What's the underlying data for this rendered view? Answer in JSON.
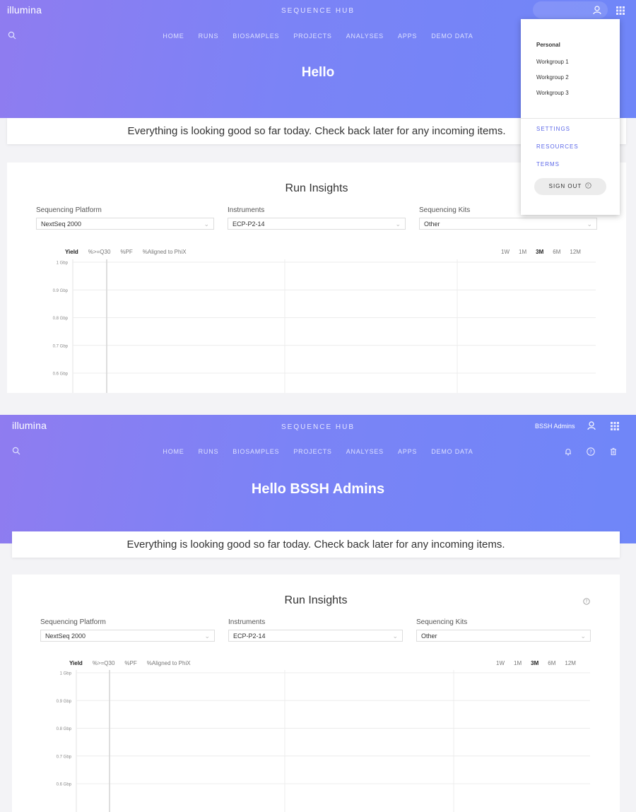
{
  "brand": "illumina",
  "app_title": "SEQUENCE HUB",
  "nav": [
    "HOME",
    "RUNS",
    "BIOSAMPLES",
    "PROJECTS",
    "ANALYSES",
    "APPS",
    "DEMO DATA"
  ],
  "status_message": "Everything is looking good so far today. Check back later for any incoming items.",
  "insights": {
    "title": "Run Insights",
    "filters": {
      "platform_label": "Sequencing Platform",
      "platform_value": "NextSeq 2000",
      "instruments_label": "Instruments",
      "instruments_value": "ECP-P2-14",
      "kits_label": "Sequencing Kits",
      "kits_value": "Other"
    },
    "metric_tabs": [
      "Yield",
      "%>=Q30",
      "%PF",
      "%Aligned to PhiX"
    ],
    "period_tabs": [
      "1W",
      "1M",
      "3M",
      "6M",
      "12M"
    ],
    "active_period": "3M",
    "active_metric": "Yield"
  },
  "chart_data": {
    "type": "line",
    "title": "",
    "xlabel": "",
    "ylabel": "",
    "y_ticks": [
      "1 Gbp",
      "0.9 Gbp",
      "0.8 Gbp",
      "0.7 Gbp",
      "0.6 Gbp"
    ],
    "y_values": [
      1.0,
      0.9,
      0.8,
      0.7,
      0.6
    ],
    "ylim": [
      0.6,
      1.0
    ],
    "series": [],
    "grid": true
  },
  "screen1": {
    "greeting": "Hello",
    "menu": {
      "personal": "Personal",
      "workgroups": [
        "Workgroup 1",
        "Workgroup 2",
        "Workgroup 3"
      ],
      "links": [
        "SETTINGS",
        "RESOURCES",
        "TERMS"
      ],
      "sign_out": "SIGN OUT"
    }
  },
  "screen2": {
    "greeting": "Hello BSSH Admins",
    "user_name": "BSSH Admins"
  },
  "colors": {
    "header_start": "#8f7cf0",
    "header_end": "#6f86f8",
    "link": "#5b67e8"
  }
}
